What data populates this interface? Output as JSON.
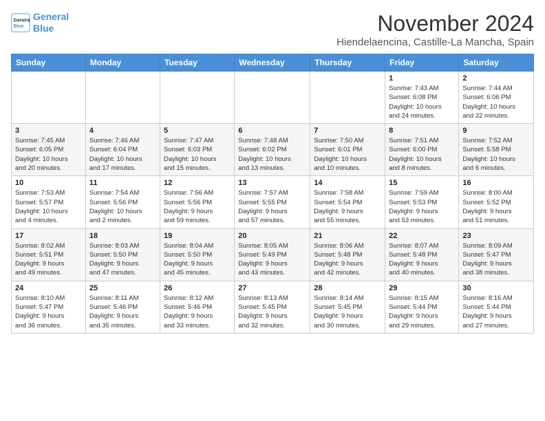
{
  "logo": {
    "line1": "General",
    "line2": "Blue"
  },
  "title": "November 2024",
  "location": "Hiendelaencina, Castille-La Mancha, Spain",
  "weekdays": [
    "Sunday",
    "Monday",
    "Tuesday",
    "Wednesday",
    "Thursday",
    "Friday",
    "Saturday"
  ],
  "weeks": [
    [
      {
        "day": "",
        "info": ""
      },
      {
        "day": "",
        "info": ""
      },
      {
        "day": "",
        "info": ""
      },
      {
        "day": "",
        "info": ""
      },
      {
        "day": "",
        "info": ""
      },
      {
        "day": "1",
        "info": "Sunrise: 7:43 AM\nSunset: 6:08 PM\nDaylight: 10 hours\nand 24 minutes."
      },
      {
        "day": "2",
        "info": "Sunrise: 7:44 AM\nSunset: 6:06 PM\nDaylight: 10 hours\nand 22 minutes."
      }
    ],
    [
      {
        "day": "3",
        "info": "Sunrise: 7:45 AM\nSunset: 6:05 PM\nDaylight: 10 hours\nand 20 minutes."
      },
      {
        "day": "4",
        "info": "Sunrise: 7:46 AM\nSunset: 6:04 PM\nDaylight: 10 hours\nand 17 minutes."
      },
      {
        "day": "5",
        "info": "Sunrise: 7:47 AM\nSunset: 6:03 PM\nDaylight: 10 hours\nand 15 minutes."
      },
      {
        "day": "6",
        "info": "Sunrise: 7:48 AM\nSunset: 6:02 PM\nDaylight: 10 hours\nand 13 minutes."
      },
      {
        "day": "7",
        "info": "Sunrise: 7:50 AM\nSunset: 6:01 PM\nDaylight: 10 hours\nand 10 minutes."
      },
      {
        "day": "8",
        "info": "Sunrise: 7:51 AM\nSunset: 6:00 PM\nDaylight: 10 hours\nand 8 minutes."
      },
      {
        "day": "9",
        "info": "Sunrise: 7:52 AM\nSunset: 5:58 PM\nDaylight: 10 hours\nand 6 minutes."
      }
    ],
    [
      {
        "day": "10",
        "info": "Sunrise: 7:53 AM\nSunset: 5:57 PM\nDaylight: 10 hours\nand 4 minutes."
      },
      {
        "day": "11",
        "info": "Sunrise: 7:54 AM\nSunset: 5:56 PM\nDaylight: 10 hours\nand 2 minutes."
      },
      {
        "day": "12",
        "info": "Sunrise: 7:56 AM\nSunset: 5:56 PM\nDaylight: 9 hours\nand 59 minutes."
      },
      {
        "day": "13",
        "info": "Sunrise: 7:57 AM\nSunset: 5:55 PM\nDaylight: 9 hours\nand 57 minutes."
      },
      {
        "day": "14",
        "info": "Sunrise: 7:58 AM\nSunset: 5:54 PM\nDaylight: 9 hours\nand 55 minutes."
      },
      {
        "day": "15",
        "info": "Sunrise: 7:59 AM\nSunset: 5:53 PM\nDaylight: 9 hours\nand 53 minutes."
      },
      {
        "day": "16",
        "info": "Sunrise: 8:00 AM\nSunset: 5:52 PM\nDaylight: 9 hours\nand 51 minutes."
      }
    ],
    [
      {
        "day": "17",
        "info": "Sunrise: 8:02 AM\nSunset: 5:51 PM\nDaylight: 9 hours\nand 49 minutes."
      },
      {
        "day": "18",
        "info": "Sunrise: 8:03 AM\nSunset: 5:50 PM\nDaylight: 9 hours\nand 47 minutes."
      },
      {
        "day": "19",
        "info": "Sunrise: 8:04 AM\nSunset: 5:50 PM\nDaylight: 9 hours\nand 45 minutes."
      },
      {
        "day": "20",
        "info": "Sunrise: 8:05 AM\nSunset: 5:49 PM\nDaylight: 9 hours\nand 43 minutes."
      },
      {
        "day": "21",
        "info": "Sunrise: 8:06 AM\nSunset: 5:48 PM\nDaylight: 9 hours\nand 42 minutes."
      },
      {
        "day": "22",
        "info": "Sunrise: 8:07 AM\nSunset: 5:48 PM\nDaylight: 9 hours\nand 40 minutes."
      },
      {
        "day": "23",
        "info": "Sunrise: 8:09 AM\nSunset: 5:47 PM\nDaylight: 9 hours\nand 38 minutes."
      }
    ],
    [
      {
        "day": "24",
        "info": "Sunrise: 8:10 AM\nSunset: 5:47 PM\nDaylight: 9 hours\nand 36 minutes."
      },
      {
        "day": "25",
        "info": "Sunrise: 8:11 AM\nSunset: 5:46 PM\nDaylight: 9 hours\nand 35 minutes."
      },
      {
        "day": "26",
        "info": "Sunrise: 8:12 AM\nSunset: 5:46 PM\nDaylight: 9 hours\nand 33 minutes."
      },
      {
        "day": "27",
        "info": "Sunrise: 8:13 AM\nSunset: 5:45 PM\nDaylight: 9 hours\nand 32 minutes."
      },
      {
        "day": "28",
        "info": "Sunrise: 8:14 AM\nSunset: 5:45 PM\nDaylight: 9 hours\nand 30 minutes."
      },
      {
        "day": "29",
        "info": "Sunrise: 8:15 AM\nSunset: 5:44 PM\nDaylight: 9 hours\nand 29 minutes."
      },
      {
        "day": "30",
        "info": "Sunrise: 8:16 AM\nSunset: 5:44 PM\nDaylight: 9 hours\nand 27 minutes."
      }
    ]
  ]
}
